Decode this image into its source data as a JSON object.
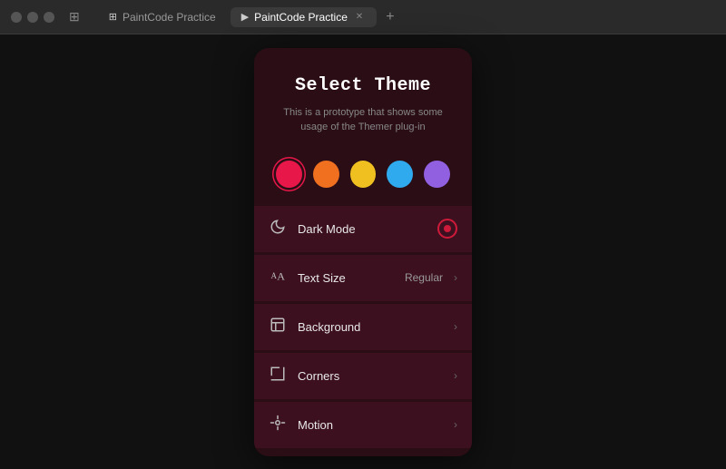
{
  "titlebar": {
    "tab1_label": "PaintCode Practice",
    "tab2_label": "PaintCode Practice",
    "new_tab_label": "+",
    "grid_icon": "⊞"
  },
  "phone": {
    "title": "Select Theme",
    "subtitle": "This is a prototype that shows some\nusage of the Themer plug-in",
    "swatches": [
      {
        "color": "#e8174a",
        "selected": true
      },
      {
        "color": "#f07020",
        "selected": false
      },
      {
        "color": "#f0c020",
        "selected": false
      },
      {
        "color": "#30aaee",
        "selected": false
      },
      {
        "color": "#9060e0",
        "selected": false
      }
    ],
    "menu_items": [
      {
        "icon": "moon",
        "label": "Dark Mode",
        "value": "",
        "toggle": true
      },
      {
        "icon": "text",
        "label": "Text Size",
        "value": "Regular",
        "chevron": true
      },
      {
        "icon": "image",
        "label": "Background",
        "value": "",
        "chevron": true
      },
      {
        "icon": "corner",
        "label": "Corners",
        "value": "",
        "chevron": true
      },
      {
        "icon": "motion",
        "label": "Motion",
        "value": "",
        "chevron": true
      }
    ]
  }
}
